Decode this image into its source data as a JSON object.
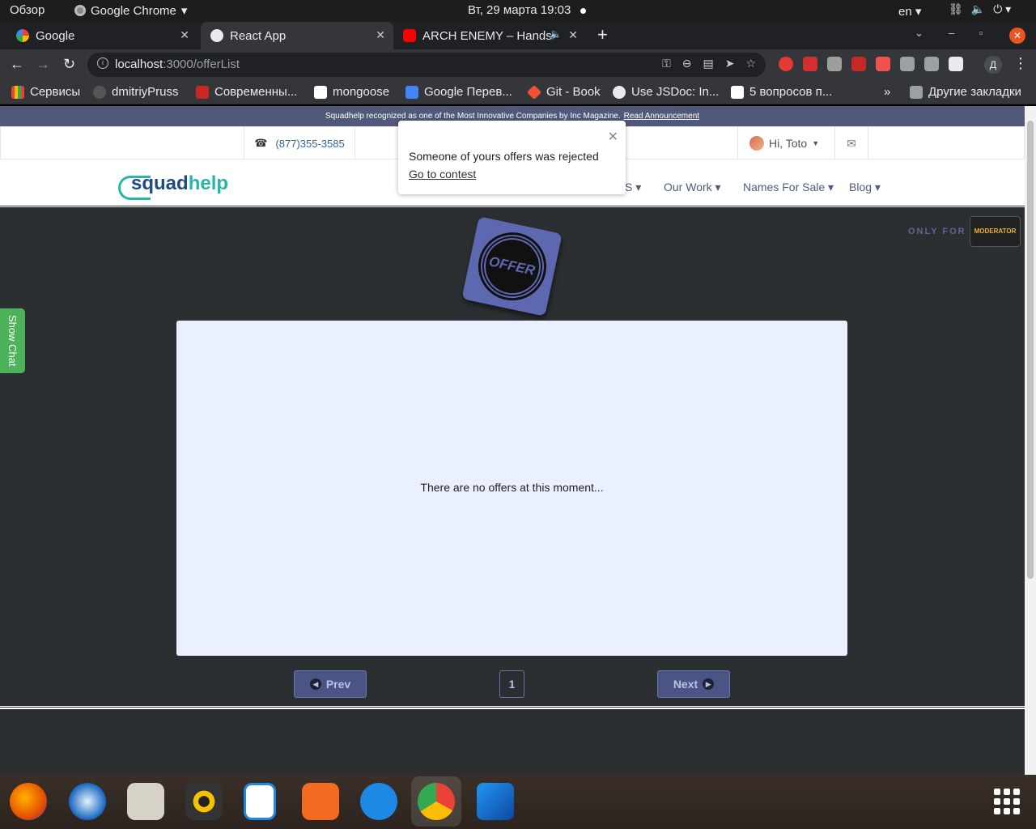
{
  "system": {
    "overview": "Обзор",
    "app_name": "Google Chrome",
    "clock": "Вт, 29 марта  19:03",
    "lang": "en"
  },
  "tabs": [
    {
      "label": "Google",
      "active": false
    },
    {
      "label": "React App",
      "active": true
    },
    {
      "label": "ARCH ENEMY – Hands",
      "active": false
    }
  ],
  "address": {
    "host": "localhost",
    "path": ":3000/offerList"
  },
  "profile_initial": "Д",
  "bookmarks": [
    "Сервисы",
    "dmitriyPruss",
    "Современны...",
    "mongoose",
    "Google Перев...",
    "Git - Book",
    "Use JSDoc: In...",
    "5 вопросов п..."
  ],
  "bookmarks_more": "»",
  "bookmarks_other": "Другие закладки",
  "site": {
    "announcement": "Squadhelp recognized as one of the Most Innovative Companies by Inc Magazine.",
    "announcement_link": "Read Announcement",
    "phone": "(877)355-3585",
    "greeting": "Hi, Toto",
    "logo_a": "squad",
    "logo_b": "help",
    "menu": [
      "S",
      "Our Work",
      "Names For Sale",
      "Blog"
    ],
    "only_for": "ONLY FOR",
    "moderator": "MODERATOR",
    "offer_badge": "OFFER",
    "show_chat": "Show Chat",
    "empty_message": "There are no offers at this moment...",
    "prev": "Prev",
    "next": "Next",
    "page": "1"
  },
  "notification": {
    "message": "Someone of yours offers was rejected",
    "link": "Go to contest"
  },
  "colors": {
    "accent": "#4b5585",
    "announce_bg": "#52587a",
    "page_bg": "#2b2f31",
    "panel_bg": "#eaf0ff",
    "chat_green": "#4cb35a"
  }
}
